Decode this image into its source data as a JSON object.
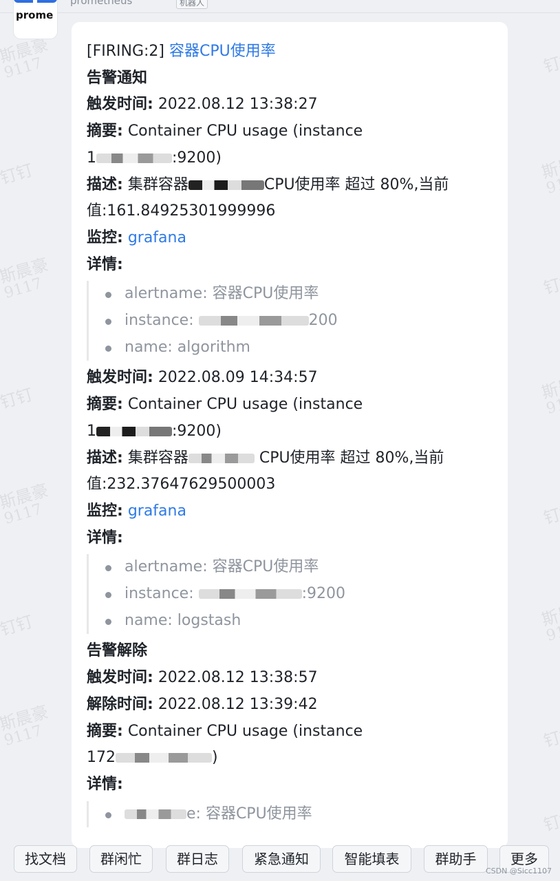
{
  "sender": {
    "name": "prometheus",
    "tag": "机器人",
    "avatar_text": "prome"
  },
  "watermark": {
    "name": "斯晨豪",
    "id": "9117",
    "app": "钉钉"
  },
  "message": {
    "title_prefix": "[FIRING:2]",
    "title_link": "容器CPU使用率",
    "section_alert": "告警通知",
    "alerts": [
      {
        "trigger_label": "触发时间:",
        "trigger_time": "2022.08.12 13:38:27",
        "summary_label": "摘要:",
        "summary_text": "Container CPU usage (instance",
        "summary_cont_a": "1",
        "summary_cont_b": ":9200)",
        "desc_label": "描述:",
        "desc_text_a": "集群容器",
        "desc_text_b": "CPU使用率 超过 80%,当前",
        "value_text": "值:161.84925301999996",
        "monitor_label": "监控:",
        "monitor_link": "grafana",
        "details_label": "详情:",
        "details": [
          {
            "text": "alertname: 容器CPU使用率"
          },
          {
            "text_a": "instance: ",
            "text_b": "200"
          },
          {
            "text": "name: algorithm"
          }
        ]
      },
      {
        "trigger_label": "触发时间:",
        "trigger_time": "2022.08.09 14:34:57",
        "summary_label": "摘要:",
        "summary_text": "Container CPU usage (instance",
        "summary_cont_a": "1",
        "summary_cont_b": ":9200)",
        "desc_label": "描述:",
        "desc_text_a": "集群容器",
        "desc_text_b": "CPU使用率 超过 80%,当前",
        "value_text": "值:232.37647629500003",
        "monitor_label": "监控:",
        "monitor_link": "grafana",
        "details_label": "详情:",
        "details": [
          {
            "text": "alertname: 容器CPU使用率"
          },
          {
            "text_a": "instance: ",
            "text_b": ":9200"
          },
          {
            "text": "name: logstash"
          }
        ]
      }
    ],
    "section_resolved": "告警解除",
    "resolved": {
      "trigger_label": "触发时间:",
      "trigger_time": "2022.08.12 13:38:57",
      "resolve_label": "解除时间:",
      "resolve_time": "2022.08.12 13:39:42",
      "summary_label": "摘要:",
      "summary_text": "Container CPU usage (instance",
      "summary_cont_a": "172",
      "summary_cont_b": ")",
      "details_label": "详情:",
      "detail_partial": "e: 容器CPU使用率"
    }
  },
  "toolbar": {
    "buttons": [
      "找文档",
      "群闲忙",
      "群日志",
      "紧急通知",
      "智能填表",
      "群助手",
      "更多"
    ]
  },
  "credit": "CSDN @Sicc1107"
}
